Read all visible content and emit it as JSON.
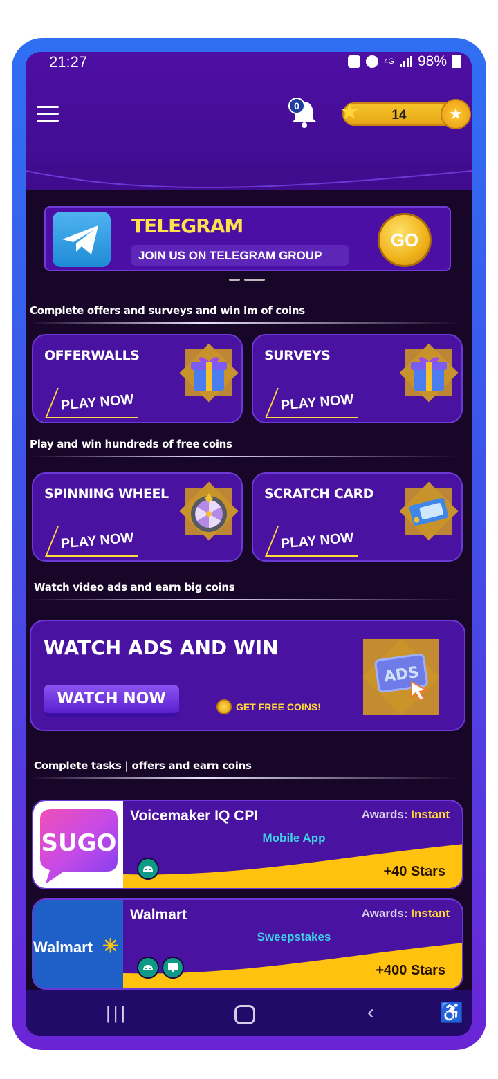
{
  "status_bar": {
    "time": "21:27",
    "network": "4G",
    "battery": "98%"
  },
  "header": {
    "notification_count": "0",
    "coin_balance": "14"
  },
  "telegram": {
    "title": "TELEGRAM",
    "subtitle": "JOIN US ON TELEGRAM GROUP",
    "go_label": "GO"
  },
  "sections": {
    "offers_label": "Complete offers and surveys and win lm of coins",
    "games_label": "Play and win hundreds of free coins",
    "video_label": "Watch video ads and earn big coins",
    "tasks_label": "Complete tasks | offers and earn coins"
  },
  "cards": [
    {
      "title": "OFFERWALLS",
      "button": "PLAY NOW",
      "icon": "gift-box-icon"
    },
    {
      "title": "SURVEYS",
      "button": "PLAY NOW",
      "icon": "gift-box-icon"
    },
    {
      "title": "SPINNING WHEEL",
      "button": "PLAY NOW",
      "icon": "spin-wheel-icon"
    },
    {
      "title": "SCRATCH CARD",
      "button": "PLAY NOW",
      "icon": "scratch-card-icon"
    }
  ],
  "watch_ads": {
    "title": "WATCH ADS AND WIN",
    "button": "WATCH NOW",
    "free_coins": "GET FREE COINS!",
    "art_text": "ADS",
    "art_icon": "ads-cursor-icon"
  },
  "offers": [
    {
      "logo_text": "SUGO",
      "title": "Voicemaker IQ CPI",
      "awards_label": "Awards:",
      "awards_value": "Instant",
      "type": "Mobile App",
      "stars": "+40 Stars",
      "platforms": [
        "android-icon"
      ]
    },
    {
      "logo_text": "Walmart",
      "title": "Walmart",
      "awards_label": "Awards:",
      "awards_value": "Instant",
      "type": "Sweepstakes",
      "stars": "+400 Stars",
      "platforms": [
        "android-icon",
        "desktop-icon"
      ]
    }
  ],
  "colors": {
    "accent_yellow": "#ffd83a",
    "card_purple": "#4a12a0",
    "teal": "#3fd2e6",
    "background": "#170627"
  }
}
